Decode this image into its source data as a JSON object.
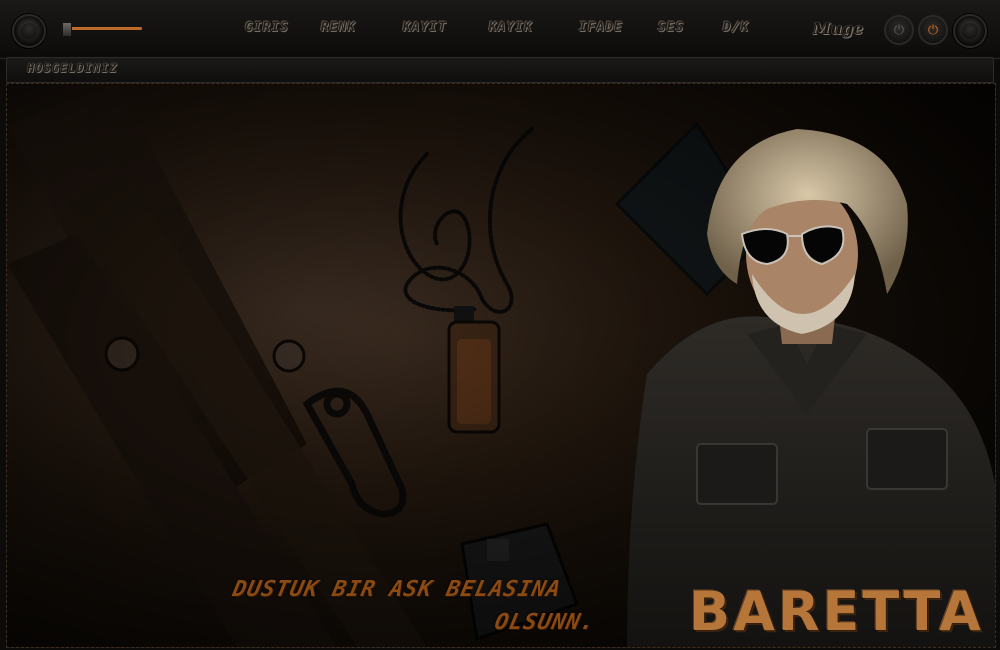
{
  "nav": {
    "items": [
      {
        "label": "GIRIS"
      },
      {
        "label": "RENK"
      },
      {
        "label": "KAYIT"
      },
      {
        "label": "KAYIK"
      },
      {
        "label": "IFADE"
      },
      {
        "label": "SES"
      },
      {
        "label": "D/K"
      }
    ]
  },
  "volume": {
    "level_percent": 100
  },
  "branding": {
    "mini_logo": "Muge"
  },
  "marquee": {
    "text": "HOSGELDINIZ"
  },
  "scene": {
    "quote_line1": "DUSTUK BIR ASK BELASINA",
    "quote_line2": "OLSUNN.",
    "signature": "BARETTA"
  },
  "colors": {
    "accent": "#d46a1e",
    "quote": "#8a4a12",
    "signature": "#b6763a"
  }
}
